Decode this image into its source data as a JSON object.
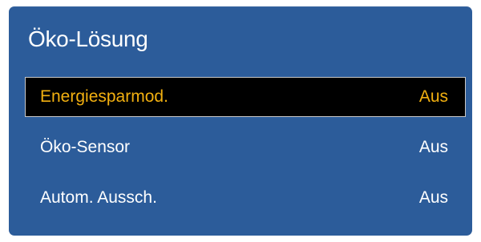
{
  "menu": {
    "title": "Öko-Lösung",
    "items": [
      {
        "label": "Energiesparmod.",
        "value": "Aus",
        "selected": true
      },
      {
        "label": "Öko-Sensor",
        "value": "Aus",
        "selected": false
      },
      {
        "label": "Autom. Aussch.",
        "value": "Aus",
        "selected": false
      }
    ]
  },
  "colors": {
    "panel_background": "#2c5c9a",
    "selected_background": "#000000",
    "selected_text": "#f2b010",
    "text": "#ffffff"
  }
}
